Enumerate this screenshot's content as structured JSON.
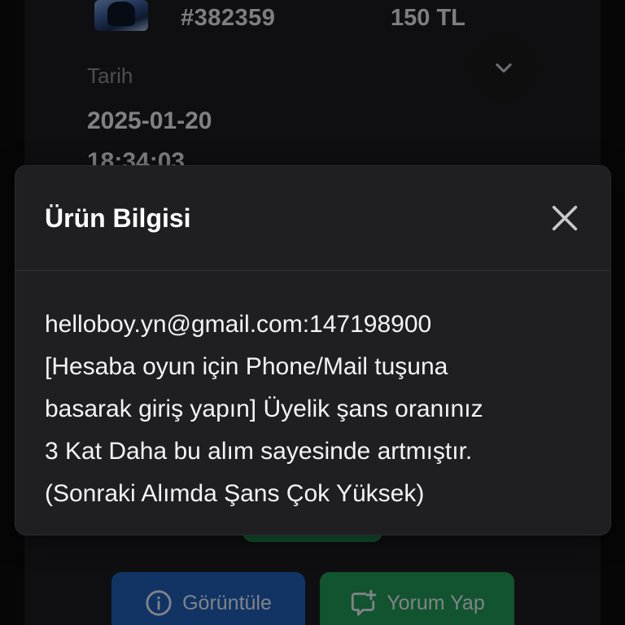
{
  "order": {
    "id": "#382359",
    "price": "150 TL",
    "date_label": "Tarih",
    "date": "2025-01-20",
    "time": "18:34:03"
  },
  "modal": {
    "title": "Ürün Bilgisi",
    "body_lines": [
      "helloboy.yn@gmail.com:147198900",
      "[Hesaba oyun için Phone/Mail tuşuna",
      "basarak giriş yapın] Üyelik şans oranınız",
      "3 Kat Daha bu alım sayesinde artmıştır.",
      "(Sonraki Alımda Şans Çok Yüksek)"
    ]
  },
  "actions": {
    "view_label": "Görüntüle",
    "comment_label": "Yorum Yap"
  },
  "colors": {
    "view_button": "#1f5fb8",
    "comment_button": "#1f9a57",
    "modal_background": "#1f1f22",
    "page_background": "#0b0b0c"
  },
  "icons": {
    "expand": "chevron-down-icon",
    "close": "close-icon",
    "view": "info-icon",
    "comment": "comment-add-icon"
  }
}
